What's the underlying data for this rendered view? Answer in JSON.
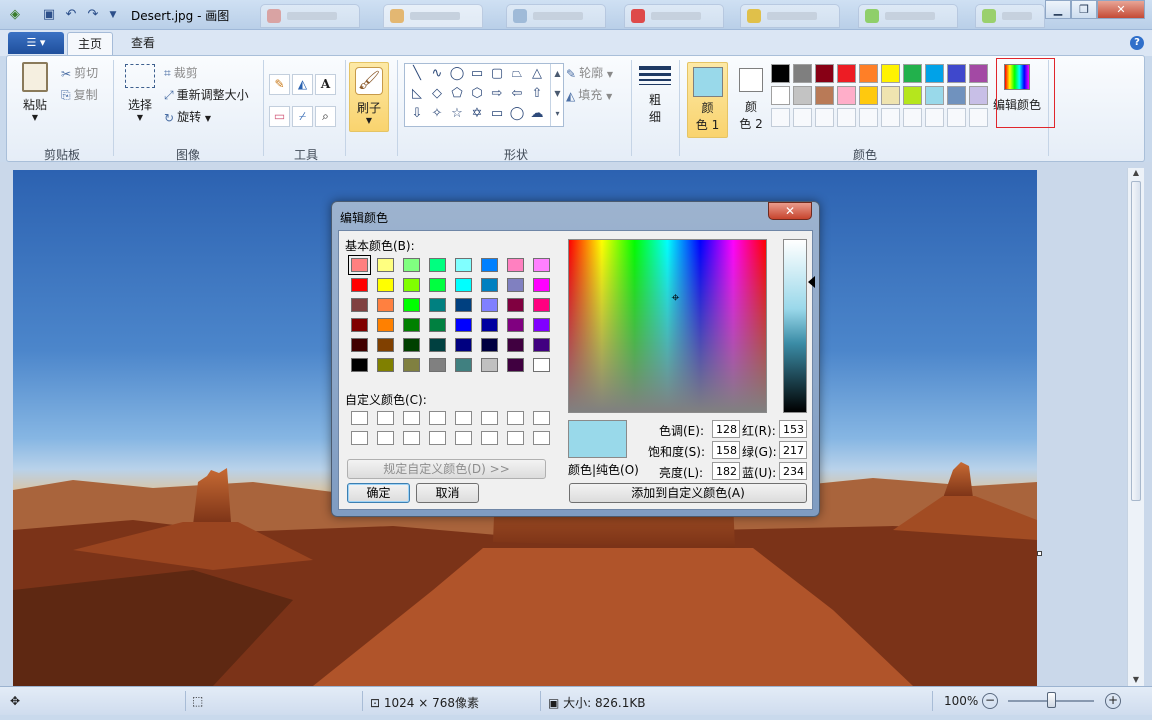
{
  "titlebar": {
    "title": "Desert.jpg - 画图",
    "quick_access": [
      "save-icon",
      "undo-icon",
      "redo-icon",
      "customize-icon"
    ],
    "window_buttons": [
      "minimize-icon",
      "restore-icon",
      "close-icon"
    ]
  },
  "ribbon_tabs": {
    "home": "主页",
    "view": "查看"
  },
  "clipboard": {
    "paste": "粘贴",
    "cut": "剪切",
    "copy": "复制",
    "label": "剪贴板"
  },
  "image": {
    "select": "选择",
    "crop": "裁剪",
    "resize": "重新调整大小",
    "rotate": "旋转",
    "label": "图像"
  },
  "tools": {
    "label": "工具",
    "brush": "刷子"
  },
  "shapes": {
    "outline": "轮廓",
    "fill": "填充",
    "label": "形状",
    "size_top": "粗",
    "size_bottom": "细"
  },
  "colors": {
    "color1_top": "颜",
    "color1_bottom": "色 1",
    "color2_top": "颜",
    "color2_bottom": "色 2",
    "edit_colors": "编辑颜色",
    "label": "颜色",
    "color1_value": "#99d9ea",
    "color2_value": "#ffffff",
    "palette_row1": [
      "#000000",
      "#7f7f7f",
      "#880015",
      "#ed1c24",
      "#ff7f27",
      "#fff200",
      "#22b14c",
      "#00a2e8",
      "#3f48cc",
      "#a349a4"
    ],
    "palette_row2": [
      "#ffffff",
      "#c3c3c3",
      "#b97a57",
      "#ffaec9",
      "#ffc90e",
      "#efe4b0",
      "#b5e61d",
      "#99d9ea",
      "#7092be",
      "#c8bfe7"
    ]
  },
  "status": {
    "dimensions": "1024 × 768像素",
    "size": "大小: 826.1KB",
    "zoom": "100%",
    "zoom_level": 1.0
  },
  "dialog": {
    "title": "编辑颜色",
    "basic_colors_label": "基本颜色(B):",
    "custom_colors_label": "自定义颜色(C):",
    "define_custom": "规定自定义颜色(D) >>",
    "ok": "确定",
    "cancel": "取消",
    "add_custom": "添加到自定义颜色(A)",
    "color_solid": "颜色|纯色(O)",
    "hue_label": "色调(E):",
    "sat_label": "饱和度(S):",
    "lum_label": "亮度(L):",
    "red_label": "红(R):",
    "green_label": "绿(G):",
    "blue_label": "蓝(U):",
    "hue": "128",
    "sat": "158",
    "lum": "182",
    "red": "153",
    "green": "217",
    "blue": "234",
    "preview_color": "#99d9ea",
    "basic_colors": [
      [
        "#ff8080",
        "#ffff80",
        "#80ff80",
        "#00ff80",
        "#80ffff",
        "#0080ff",
        "#ff80c0",
        "#ff80ff"
      ],
      [
        "#ff0000",
        "#ffff00",
        "#80ff00",
        "#00ff40",
        "#00ffff",
        "#0080c0",
        "#8080c0",
        "#ff00ff"
      ],
      [
        "#804040",
        "#ff8040",
        "#00ff00",
        "#008080",
        "#004080",
        "#8080ff",
        "#800040",
        "#ff0080"
      ],
      [
        "#800000",
        "#ff8000",
        "#008000",
        "#008040",
        "#0000ff",
        "#0000a0",
        "#800080",
        "#8000ff"
      ],
      [
        "#400000",
        "#804000",
        "#004000",
        "#004040",
        "#000080",
        "#000040",
        "#400040",
        "#400080"
      ],
      [
        "#000000",
        "#808000",
        "#808040",
        "#808080",
        "#408080",
        "#c0c0c0",
        "#400040",
        "#ffffff"
      ]
    ]
  }
}
